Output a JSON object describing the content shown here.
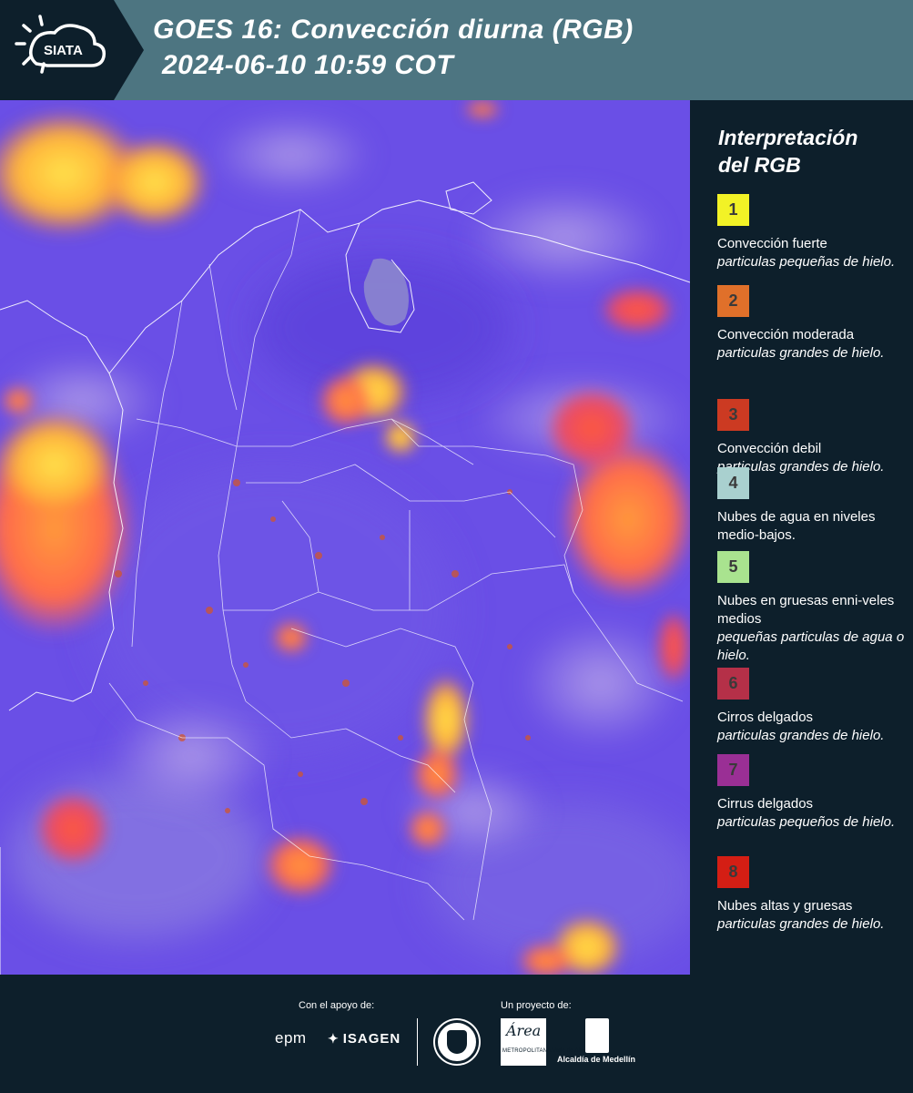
{
  "header": {
    "logo_text": "SIATA",
    "title_line1": "GOES 16: Convección diurna (RGB)",
    "title_line2": "2024-06-10 10:59 COT",
    "background_color": "#4d7581"
  },
  "legend": {
    "title_line1": "Interpretación",
    "title_line2": "del RGB",
    "items": [
      {
        "number": "1",
        "color": "#f2f226",
        "label": "Convección fuerte",
        "desc": "particulas pequeñas de hielo."
      },
      {
        "number": "2",
        "color": "#e0702a",
        "label": "Convección moderada",
        "desc": "particulas grandes de hielo."
      },
      {
        "number": "3",
        "color": "#cc3a22",
        "label": "Convección debil",
        "desc": "particulas grandes de hielo."
      },
      {
        "number": "4",
        "color": "#a9d0cf",
        "label": "Nubes de agua en niveles medio-bajos.",
        "desc": ""
      },
      {
        "number": "5",
        "color": "#a9e38f",
        "label": "Nubes en gruesas enni-veles medios",
        "desc": "pequeñas particulas de agua o hielo."
      },
      {
        "number": "6",
        "color": "#b53048",
        "label": "Cirros delgados",
        "desc": "particulas grandes de hielo."
      },
      {
        "number": "7",
        "color": "#9a2f95",
        "label": "Cirrus delgados",
        "desc": "particulas pequeños de hielo."
      },
      {
        "number": "8",
        "color": "#d41e14",
        "label": "Nubes altas y gruesas",
        "desc": "particulas grandes de hielo."
      }
    ]
  },
  "footer": {
    "support_label": "Con el apoyo de:",
    "project_label": "Un proyecto de:",
    "epm_text": "epm",
    "isagen_text": "ISAGEN",
    "amva_script": "Área",
    "amva_small": "METROPOLITANA Valle de Aburrá",
    "alcaldia_text": "Alcaldía de Medellín"
  },
  "map": {
    "base_color": "#6a4fe6",
    "icon": "satellite-rgb-image"
  }
}
